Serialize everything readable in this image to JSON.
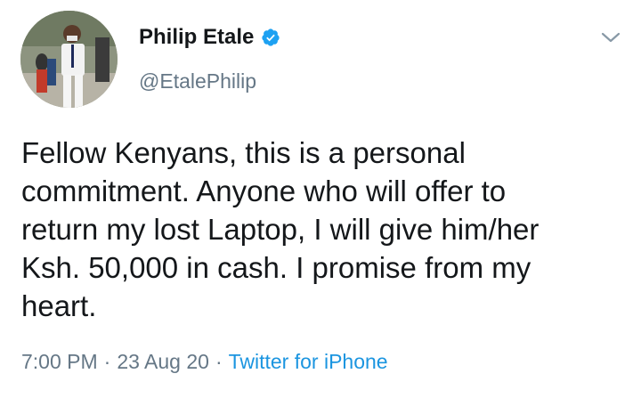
{
  "author": {
    "name": "Philip Etale",
    "handle": "@EtalePhilip",
    "verified": true
  },
  "tweet": {
    "text": "Fellow Kenyans, this is a personal\ncommitment. Anyone who will offer to\nreturn my lost Laptop, I will give him/her\nKsh. 50,000 in cash. I promise from my\nheart."
  },
  "meta": {
    "time": "7:00 PM",
    "separator": "·",
    "date": "23 Aug 20",
    "source": "Twitter for iPhone"
  },
  "icons": {
    "verified": "verified-badge-icon",
    "menu": "chevron-down-icon"
  },
  "colors": {
    "text": "#14171a",
    "secondary": "#657786",
    "accent": "#1b95e0",
    "badge": "#1da1f2"
  }
}
